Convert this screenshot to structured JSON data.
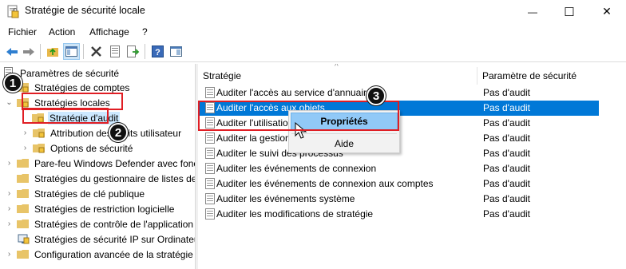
{
  "window": {
    "title": "Stratégie de sécurité locale",
    "minimize_glyph": "—",
    "maximize_glyph": "☐",
    "close_glyph": "✕"
  },
  "menu": {
    "items": [
      "Fichier",
      "Action",
      "Affichage",
      "?"
    ]
  },
  "toolbar": {
    "buttons": [
      "back-arrow-icon",
      "forward-arrow-icon",
      "up-folder-icon",
      "show-hide-tree-icon",
      "delete-icon",
      "properties-icon",
      "export-list-icon",
      "help-icon",
      "console-view-icon"
    ]
  },
  "tree": {
    "root": "Paramètres de sécurité",
    "items": [
      "Stratégies de comptes",
      "Stratégies locales",
      "Stratégie d'audit",
      "Attribution des droits utilisateur",
      "Options de sécurité",
      "Pare-feu Windows Defender avec fonctions avancées de sécurité",
      "Stratégies du gestionnaire de listes de réseaux",
      "Stratégies de clé publique",
      "Stratégies de restriction logicielle",
      "Stratégies de contrôle de l'application",
      "Stratégies de sécurité IP sur Ordinateur local",
      "Configuration avancée de la stratégie d'audit"
    ]
  },
  "list": {
    "col_policy": "Stratégie",
    "col_setting": "Paramètre de sécurité",
    "rows": [
      {
        "name": "Auditer l'accès au service d'annuaire",
        "value": "Pas d'audit"
      },
      {
        "name": "Auditer l'accès aux objets",
        "value": "Pas d'audit"
      },
      {
        "name": "Auditer l'utilisation des privilèges",
        "value": "Pas d'audit"
      },
      {
        "name": "Auditer la gestion des comptes",
        "value": "Pas d'audit"
      },
      {
        "name": "Auditer le suivi des processus",
        "value": "Pas d'audit"
      },
      {
        "name": "Auditer les événements de connexion",
        "value": "Pas d'audit"
      },
      {
        "name": "Auditer les événements de connexion aux comptes",
        "value": "Pas d'audit"
      },
      {
        "name": "Auditer les événements système",
        "value": "Pas d'audit"
      },
      {
        "name": "Auditer les modifications de stratégie",
        "value": "Pas d'audit"
      }
    ]
  },
  "context_menu": {
    "items": [
      "Propriétés",
      "Aide"
    ]
  },
  "annotations": {
    "badges": [
      "1",
      "2",
      "3"
    ],
    "color": "#e01e24"
  },
  "colors": {
    "selection": "#0078d7",
    "menu_hover": "#91c9f7",
    "tree_selection": "#cce8ff"
  }
}
